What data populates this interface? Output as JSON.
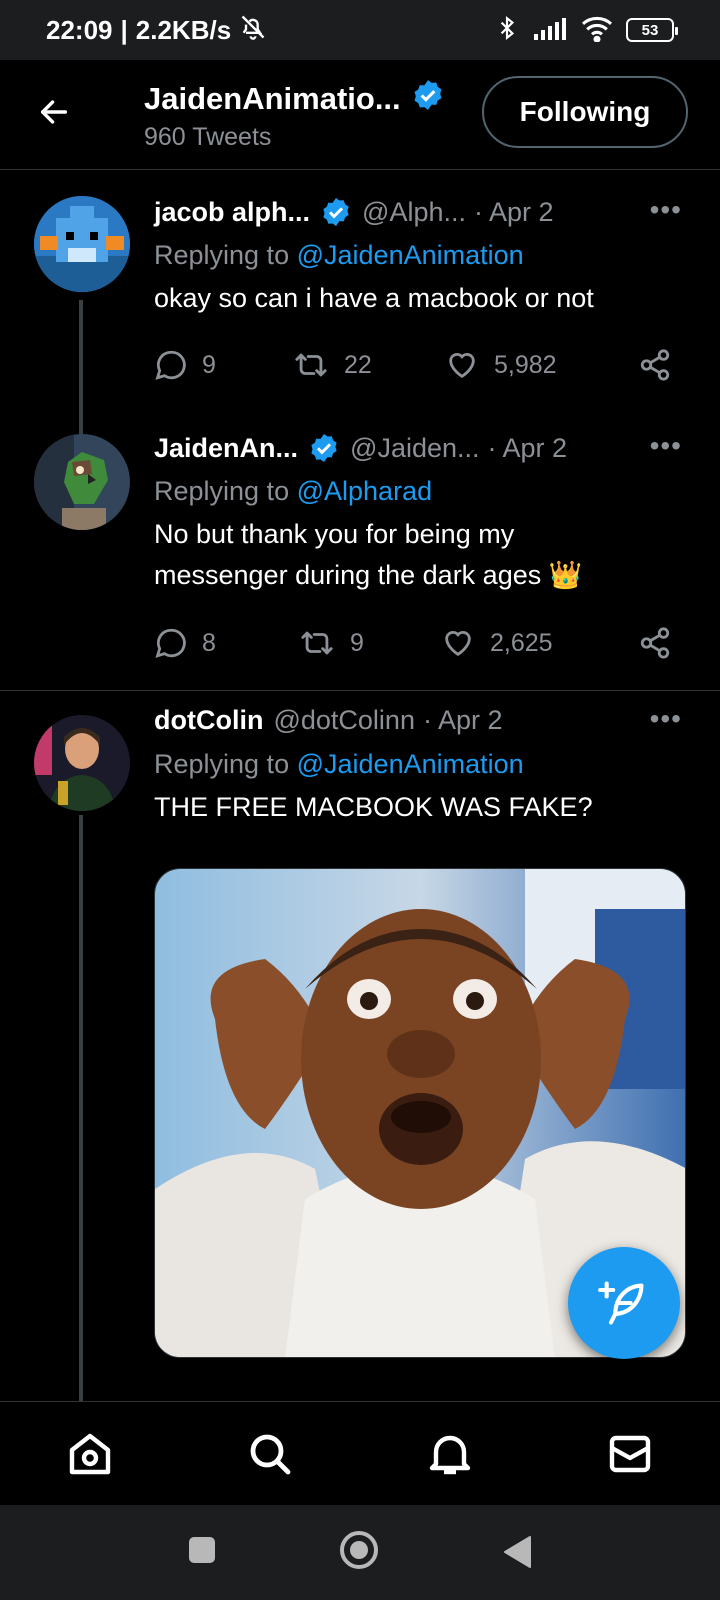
{
  "status_bar": {
    "time": "22:09",
    "separator": "|",
    "speed": "2.2KB/s",
    "battery": "53",
    "icons": [
      "bell-off-icon",
      "bluetooth-icon",
      "signal-icon",
      "wifi-icon",
      "battery-icon"
    ]
  },
  "header": {
    "title": "JaidenAnimatio...",
    "subtitle": "960 Tweets",
    "follow_label": "Following"
  },
  "tweets": [
    {
      "name": "jacob alph...",
      "handle": "@Alph...",
      "date": "· Apr 2",
      "reply_prefix": "Replying to",
      "reply_to": "@JaidenAnimation",
      "text": "okay so can i have a macbook or not",
      "replies": "9",
      "retweets": "22",
      "likes": "5,982"
    },
    {
      "name": "JaidenAn...",
      "handle": "@Jaiden...",
      "date": "· Apr 2",
      "reply_prefix": "Replying to",
      "reply_to": "@Alpharad",
      "text": "No but thank you for being my messenger during the dark ages 👑",
      "replies": "8",
      "retweets": "9",
      "likes": "2,625"
    },
    {
      "name": "dotColin",
      "handle": "@dotColinn",
      "date": "· Apr 2",
      "reply_prefix": "Replying to",
      "reply_to": "@JaidenAnimation",
      "text": "THE FREE MACBOOK WAS FAKE?"
    }
  ],
  "more_label": "•••",
  "colors": {
    "accent": "#1d9bf0",
    "background": "#000000",
    "muted": "#8b9196"
  },
  "nav": [
    "home-icon",
    "search-icon",
    "notifications-icon",
    "messages-icon"
  ]
}
